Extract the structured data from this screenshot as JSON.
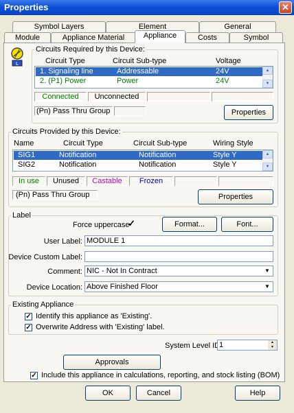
{
  "window": {
    "title": "Properties",
    "close_glyph": "✕"
  },
  "tabs_row1": [
    "Symbol Layers",
    "Element",
    "General"
  ],
  "tabs_row2": [
    "Module",
    "Appliance Material",
    "Appliance",
    "Costs",
    "Symbol"
  ],
  "required": {
    "legend": "Circuits Required by this Device:",
    "headers": [
      "Circuit Type",
      "Circuit Sub-type",
      "Voltage"
    ],
    "rows": [
      {
        "type": "1.  Signaling line",
        "subtype": "Addressable",
        "voltage": "24V"
      },
      {
        "type": "2.  (P1) Power",
        "subtype": "Power",
        "voltage": "24V"
      }
    ],
    "status": {
      "connected": "Connected",
      "unconnected": "Unconnected"
    },
    "status_colors": {
      "connected": "#008000",
      "unconnected": "#000000"
    },
    "pass_thru": "(Pn) Pass Thru Group",
    "properties_button": "Properties"
  },
  "provided": {
    "legend": "Circuits Provided by this Device:",
    "headers": [
      "Name",
      "Circuit Type",
      "Circuit Sub-type",
      "Wiring Style"
    ],
    "rows": [
      {
        "name": "SIG1",
        "type": "Notification",
        "subtype": "Notification",
        "style": "Style Y"
      },
      {
        "name": "SIG2",
        "type": "Notification",
        "subtype": "Notification",
        "style": "Style Y"
      }
    ],
    "status": {
      "inuse": "In use",
      "unused": "Unused",
      "castable": "Castable",
      "frozen": "Frozen"
    },
    "status_colors": {
      "inuse": "#008000",
      "unused": "#000000",
      "castable": "#c000c0",
      "frozen": "#0000c0"
    },
    "pass_thru": "(Pn) Pass Thru Group",
    "properties_button": "Properties"
  },
  "label": {
    "legend": "Label",
    "force_uppercase": "Force uppercase",
    "format_button": "Format...",
    "font_button": "Font...",
    "user_label": {
      "label": "User Label:",
      "value": "MODULE 1"
    },
    "custom_label": {
      "label": "Device Custom Label:",
      "value": ""
    },
    "comment": {
      "label": "Comment:",
      "value": "NIC - Not In Contract"
    },
    "location": {
      "label": "Device Location:",
      "value": "Above Finished Floor"
    }
  },
  "existing": {
    "legend": "Existing Appliance",
    "identify": "Identify this appliance as 'Existing'.",
    "overwrite": "Overwrite Address with 'Existing' label."
  },
  "system_level": {
    "label": "System Level ID:",
    "value": "1"
  },
  "approvals_button": "Approvals",
  "include_bom": "Include this appliance in calculations, reporting, and stock listing (BOM)",
  "footer": {
    "ok": "OK",
    "cancel": "Cancel",
    "help": "Help"
  },
  "icons": {
    "check": "✓",
    "arrow_up": "▲",
    "arrow_down": "▼"
  }
}
